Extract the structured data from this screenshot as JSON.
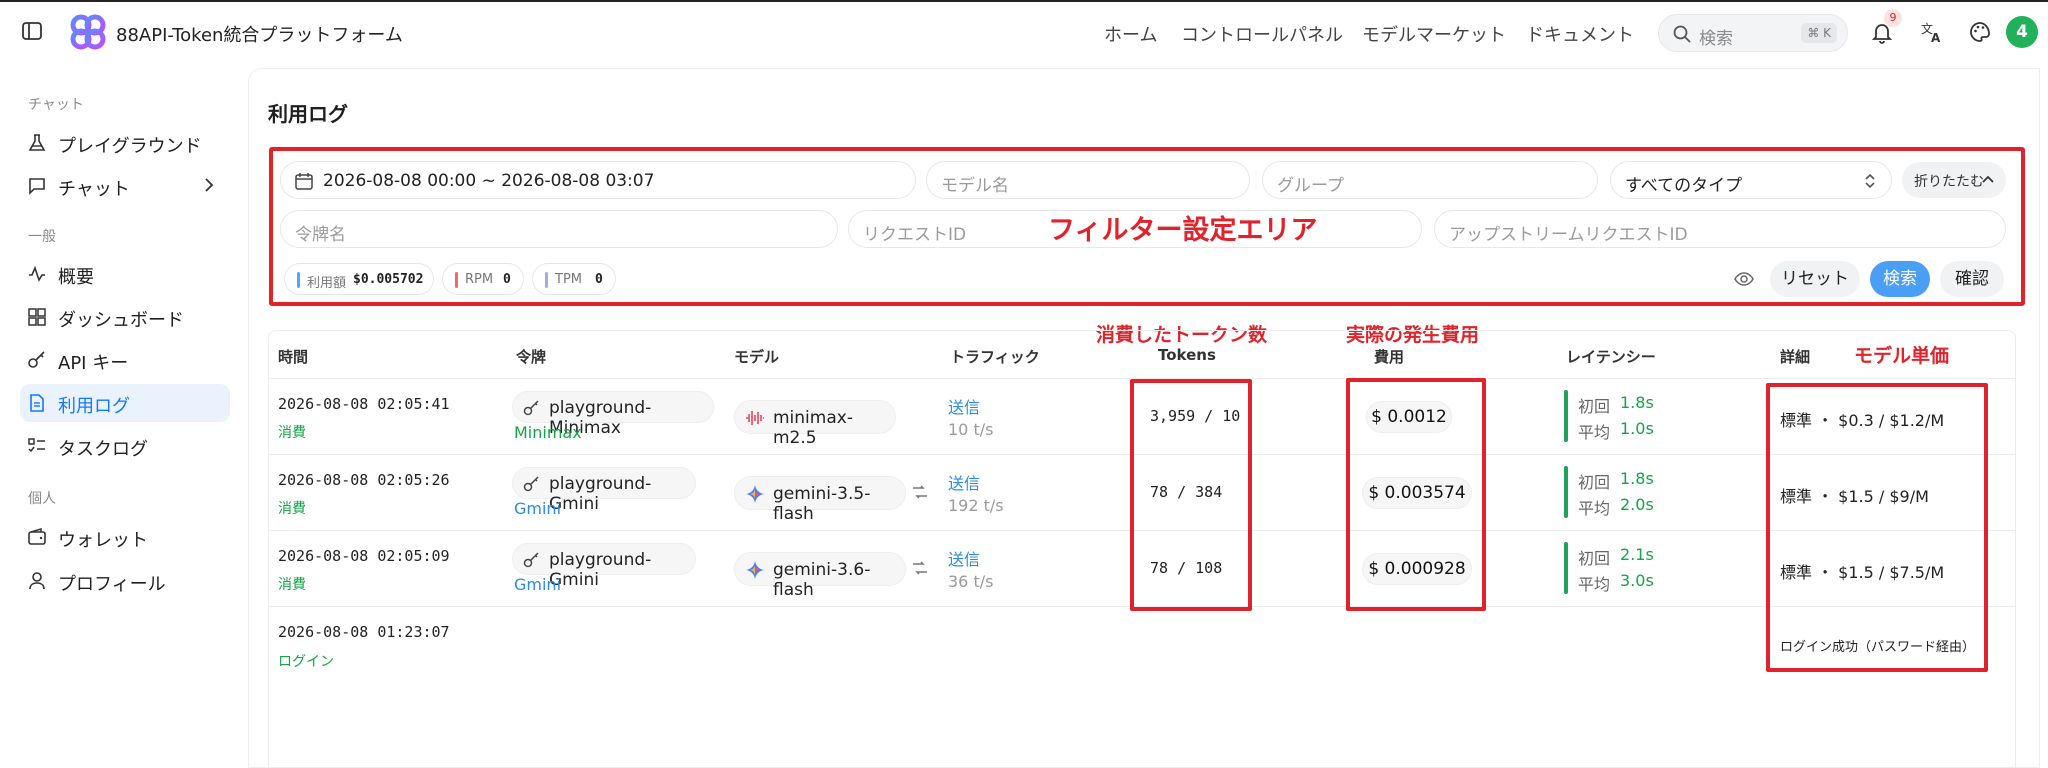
{
  "app": {
    "title": "88API-Token統合プラットフォーム"
  },
  "nav": {
    "home": "ホーム",
    "console": "コントロールパネル",
    "market": "モデルマーケット",
    "docs": "ドキュメント"
  },
  "search": {
    "placeholder": "検索",
    "shortcut": "⌘ K"
  },
  "notifications": {
    "count": "9"
  },
  "user": {
    "avatar": "4"
  },
  "sidebar": {
    "sections": {
      "chat": "チャット",
      "general": "一般",
      "personal": "個人"
    },
    "items": [
      {
        "label": "プレイグラウンド",
        "icon": "flask-icon"
      },
      {
        "label": "チャット",
        "icon": "message-icon"
      },
      {
        "label": "概要",
        "icon": "activity-icon"
      },
      {
        "label": "ダッシュボード",
        "icon": "dashboard-icon"
      },
      {
        "label": "API キー",
        "icon": "key-icon"
      },
      {
        "label": "利用ログ",
        "icon": "log-icon",
        "active": true
      },
      {
        "label": "タスクログ",
        "icon": "task-icon"
      },
      {
        "label": "ウォレット",
        "icon": "wallet-icon"
      },
      {
        "label": "プロフィール",
        "icon": "user-icon"
      }
    ]
  },
  "page": {
    "title": "利用ログ"
  },
  "filters": {
    "date_range": "2026-08-08 00:00 ~ 2026-08-08 03:07",
    "model_placeholder": "モデル名",
    "group_placeholder": "グループ",
    "type_value": "すべてのタイプ",
    "collapse": "折りたたむ",
    "token_placeholder": "令牌名",
    "request_placeholder": "リクエストID",
    "upstream_placeholder": "アップストリームリクエストID",
    "stats": {
      "usage_label": "利用額",
      "usage_value": "$0.005702",
      "rpm_label": "RPM",
      "rpm_value": "0",
      "tpm_label": "TPM",
      "tpm_value": "0"
    },
    "reset": "リセット",
    "search": "検索",
    "confirm": "確認"
  },
  "annotations": {
    "filter_area": "フィルター設定エリア",
    "tokens": "消費したトークン数",
    "cost": "実際の発生費用",
    "unit_price": "モデル単価"
  },
  "table": {
    "headers": {
      "time": "時間",
      "token": "令牌",
      "model": "モデル",
      "traffic": "トラフィック",
      "tokens": "Tokens",
      "cost": "費用",
      "latency": "レイテンシー",
      "detail": "詳細"
    },
    "latency_labels": {
      "first": "初回",
      "avg": "平均"
    },
    "rows": [
      {
        "time": "2026-08-08 02:05:41",
        "kind": "消費",
        "token": "playground-Minimax",
        "group": "Minimax",
        "model": "minimax-m2.5",
        "traffic": "送信",
        "speed": "10 t/s",
        "tokens": "3,959 / 10",
        "cost": "$ 0.0012",
        "first": "1.8s",
        "avg": "1.0s",
        "detail": "標準 ・ $0.3 / $1.2/M"
      },
      {
        "time": "2026-08-08 02:05:26",
        "kind": "消費",
        "token": "playground-Gmini",
        "group": "Gmini",
        "model": "gemini-3.5-flash",
        "traffic": "送信",
        "speed": "192 t/s",
        "tokens": "78 / 384",
        "cost": "$ 0.003574",
        "first": "1.8s",
        "avg": "2.0s",
        "detail": "標準 ・ $1.5 / $9/M"
      },
      {
        "time": "2026-08-08 02:05:09",
        "kind": "消費",
        "token": "playground-Gmini",
        "group": "Gmini",
        "model": "gemini-3.6-flash",
        "traffic": "送信",
        "speed": "36 t/s",
        "tokens": "78 / 108",
        "cost": "$ 0.000928",
        "first": "2.1s",
        "avg": "3.0s",
        "detail": "標準 ・ $1.5 / $7.5/M"
      },
      {
        "time": "2026-08-08 01:23:07",
        "kind": "ログイン",
        "detail": "ログイン成功（パスワード経由）"
      }
    ]
  },
  "colors": {
    "accent": "#1677ff",
    "annotation": "#e0222a",
    "success": "#16a34a",
    "link": "#2b8ce0",
    "primary_button": "#4a9ff5"
  }
}
